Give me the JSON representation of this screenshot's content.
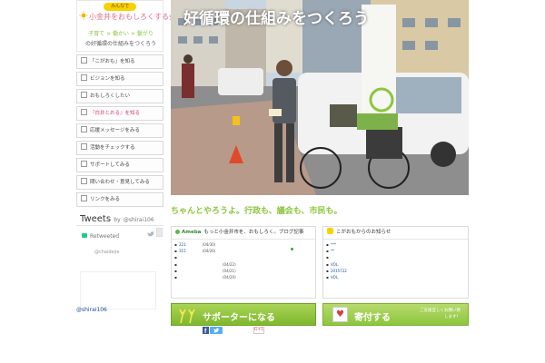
{
  "logo": {
    "badge": "みんなで",
    "title": "小金井をおもしろくする会",
    "sub": "子育て × 働かい × 繋がり",
    "sub2": "の好循環の仕組みをつくろう"
  },
  "menu": [
    {
      "label": "「こがおも」を知る",
      "highlight": false
    },
    {
      "label": "ビジョンを知る",
      "highlight": false
    },
    {
      "label": "おもしろくしたい",
      "highlight": false
    },
    {
      "label": "『白井とおる』を知る",
      "highlight": true
    },
    {
      "label": "応援メッセージをみる",
      "highlight": false
    },
    {
      "label": "活動をチェックする",
      "highlight": false
    },
    {
      "label": "サポートしてみる",
      "highlight": false
    },
    {
      "label": "問い合わせ・意見してみる",
      "highlight": false
    },
    {
      "label": "リンクをみる",
      "highlight": false
    }
  ],
  "hero": {
    "title": "好循環の仕組みをつくろう",
    "tagline": "ちゃんとやろうよ。行政も、議会も、市民も。"
  },
  "tweets": {
    "title": "Tweets",
    "by": "by",
    "handle": "@shirai106",
    "retweeted": "Retweeted",
    "user": "@chaidejie",
    "footer": "@shirai106"
  },
  "ameba": {
    "label": "Ameba",
    "title": "もっと小金井市を、おもしろく。ブログ記事",
    "entries": [
      {
        "title": "221",
        "date": "(04/30)"
      },
      {
        "title": "315",
        "date": "(04/26)"
      },
      {
        "title": "",
        "date": ""
      },
      {
        "title": "",
        "date": "(04/22)"
      },
      {
        "title": "",
        "date": "(04/21)"
      },
      {
        "title": "",
        "date": "(04/20)"
      }
    ]
  },
  "kogaomo": {
    "title": "こがおもからのお知らせ",
    "entries": [
      {
        "title": "***"
      },
      {
        "title": "**"
      },
      {
        "title": ""
      },
      {
        "title": "VOL."
      },
      {
        "title": "2015722"
      },
      {
        "title": "VOL."
      }
    ]
  },
  "banners": {
    "supporter": "サポーターになる",
    "donate": "寄付する",
    "donate_note": "ご支援宜しくお願い致します！"
  },
  "social": {
    "gplus": "G+1"
  }
}
